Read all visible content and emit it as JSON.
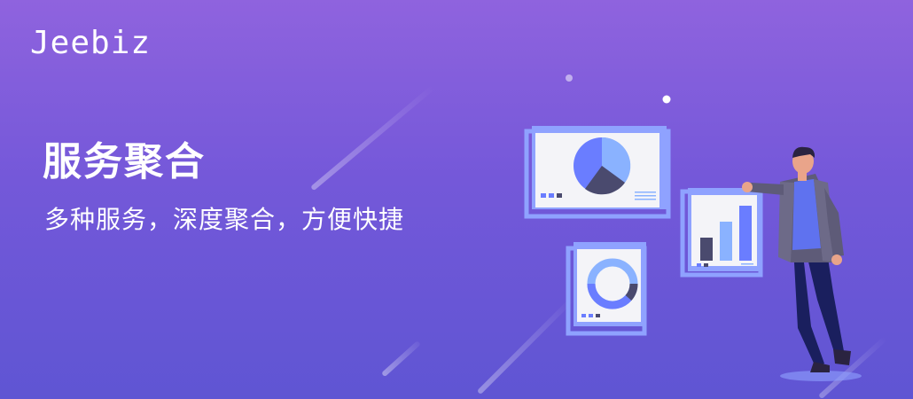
{
  "brand": {
    "logo_text": "Jeebiz"
  },
  "hero": {
    "title": "服务聚合",
    "subtitle": "多种服务，深度聚合，方便快捷"
  },
  "colors": {
    "gradient_top": "#8f63de",
    "gradient_bottom": "#5f55d3",
    "card_frame": "#8fa2ff",
    "card_bg": "#f4f4f8",
    "chart_blue": "#6a7dff",
    "chart_dark": "#4a4a6e",
    "chart_light": "#8ab2ff",
    "jacket": "#5e5b78",
    "shirt": "#5f72ef",
    "pants": "#1a1f5e",
    "skin": "#e9a48a",
    "hair": "#2a2340"
  },
  "icons": [
    "pie-chart-icon",
    "bar-chart-icon",
    "donut-chart-icon",
    "person-illustration"
  ]
}
